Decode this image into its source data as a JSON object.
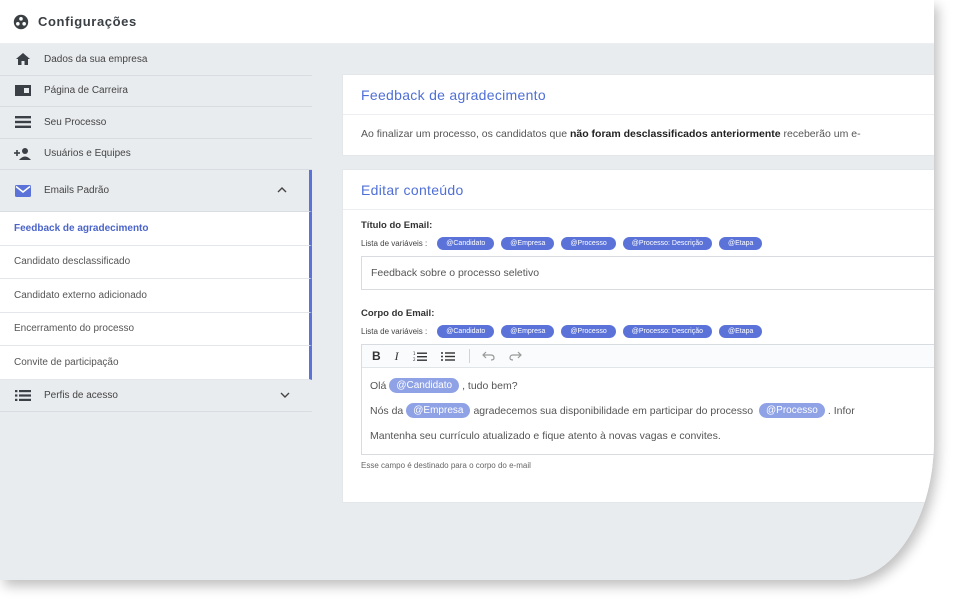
{
  "app": {
    "title": "Configurações"
  },
  "sidebar": {
    "items": [
      {
        "label": "Dados da sua empresa",
        "icon": "home-icon"
      },
      {
        "label": "Página de Carreira",
        "icon": "card-icon"
      },
      {
        "label": "Seu Processo",
        "icon": "list-icon"
      },
      {
        "label": "Usuários e Equipes",
        "icon": "add-user-icon"
      }
    ],
    "emails_group": {
      "label": "Emails Padrão",
      "icon": "mail-icon",
      "subitems": [
        "Feedback de agradecimento",
        "Candidato desclassificado",
        "Candidato externo adicionado",
        "Encerramento do processo",
        "Convite de participação"
      ],
      "active": "Feedback de agradecimento"
    },
    "profiles_group": {
      "label": "Perfis de acesso",
      "icon": "list-icon"
    }
  },
  "main": {
    "info_card": {
      "title": "Feedback de agradecimento",
      "text_before": "Ao finalizar um processo, os candidatos que ",
      "text_bold": "não foram desclassificados anteriormente",
      "text_after": " receberão um e-"
    },
    "edit_card": {
      "title": "Editar conteúdo",
      "subject_label": "Título do Email:",
      "vars_label": "Lista de variáveis :",
      "variables": [
        "@Candidato",
        "@Empresa",
        "@Processo",
        "@Processo: Descrição",
        "@Etapa"
      ],
      "subject_value": "Feedback sobre o processo seletivo",
      "body_label": "Corpo do Email:",
      "toolbar": {
        "bold": "B",
        "italic": "I",
        "ordered_list": "ordered-list-icon",
        "bullet_list": "bullet-list-icon",
        "undo": "undo-icon",
        "redo": "redo-icon"
      },
      "body": {
        "line1_a": "Olá",
        "line1_tag": "@Candidato",
        "line1_b": ", tudo bem?",
        "line2_a": "Nós da",
        "line2_tag1": "@Empresa",
        "line2_b": "agradecemos sua disponibilidade em participar do processo",
        "line2_tag2": "@Processo",
        "line2_c": ". Infor",
        "line3": "Mantenha seu currículo atualizado e fique atento à novas vagas e convites."
      },
      "hint": "Esse campo é destinado para o corpo do e-mail"
    }
  },
  "colors": {
    "accent": "#5b73d9",
    "title_blue": "#4f6fd6",
    "tag": "#8fa2e6",
    "sidebar_bg": "#e9ecef"
  }
}
